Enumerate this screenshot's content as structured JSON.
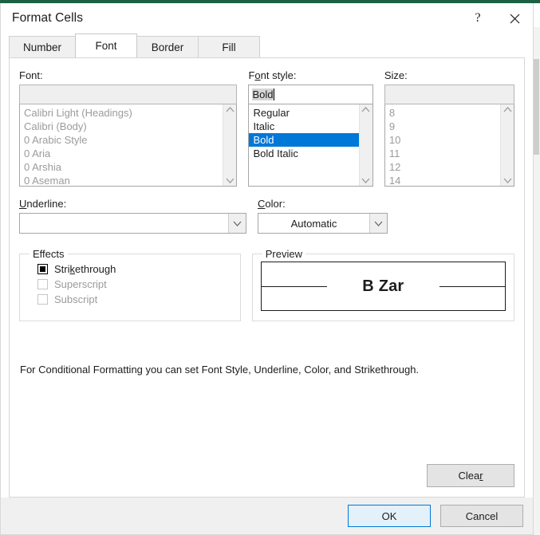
{
  "window": {
    "title": "Format Cells",
    "help_button": "?",
    "close_button": "✕"
  },
  "tabs": [
    {
      "label": "Number",
      "active": false
    },
    {
      "label": "Font",
      "active": true
    },
    {
      "label": "Border",
      "active": false
    },
    {
      "label": "Fill",
      "active": false
    }
  ],
  "font_section": {
    "label": "Font:",
    "input_value": "",
    "input_disabled": true,
    "items": [
      "Calibri Light (Headings)",
      "Calibri (Body)",
      "0 Arabic Style",
      "0 Aria",
      "0 Arshia",
      "0 Aseman"
    ]
  },
  "font_style_section": {
    "label_pre": "F",
    "label_accel": "o",
    "label_post": "nt style:",
    "label_full": "Font style:",
    "input_value": "Bold",
    "items": [
      {
        "label": "Regular",
        "selected": false
      },
      {
        "label": "Italic",
        "selected": false
      },
      {
        "label": "Bold",
        "selected": true
      },
      {
        "label": "Bold Italic",
        "selected": false
      }
    ]
  },
  "size_section": {
    "label": "Size:",
    "input_value": "",
    "input_disabled": true,
    "items": [
      "8",
      "9",
      "10",
      "11",
      "12",
      "14"
    ]
  },
  "underline_section": {
    "label_pre": "",
    "label_accel": "U",
    "label_post": "nderline:",
    "label_full": "Underline:",
    "value": ""
  },
  "color_section": {
    "label_pre": "",
    "label_accel": "C",
    "label_post": "olor:",
    "label_full": "Color:",
    "value": "Automatic"
  },
  "effects_section": {
    "legend": "Effects",
    "items": [
      {
        "label_pre": "Stri",
        "label_accel": "k",
        "label_post": "ethrough",
        "label_full": "Strikethrough",
        "state": "indeterminate",
        "disabled": false
      },
      {
        "label_pre": "Superscript",
        "label_accel": "",
        "label_post": "",
        "label_full": "Superscript",
        "state": "off",
        "disabled": true
      },
      {
        "label_pre": "Subscript",
        "label_accel": "",
        "label_post": "",
        "label_full": "Subscript",
        "state": "off",
        "disabled": true
      }
    ]
  },
  "preview_section": {
    "legend": "Preview",
    "sample_text": "B Zar"
  },
  "description": "For Conditional Formatting you can set Font Style, Underline, Color, and Strikethrough.",
  "clear_button": {
    "label_pre": "Clea",
    "label_accel": "r",
    "label_full": "Clear"
  },
  "footer": {
    "ok_label": "OK",
    "cancel_label": "Cancel"
  },
  "colors": {
    "accent": "#0078d7",
    "selection_blue": "#0078d7",
    "titlebar_accent": "#1d6044",
    "dialog_bg": "#ffffff",
    "footer_bg": "#f0f0f0"
  }
}
